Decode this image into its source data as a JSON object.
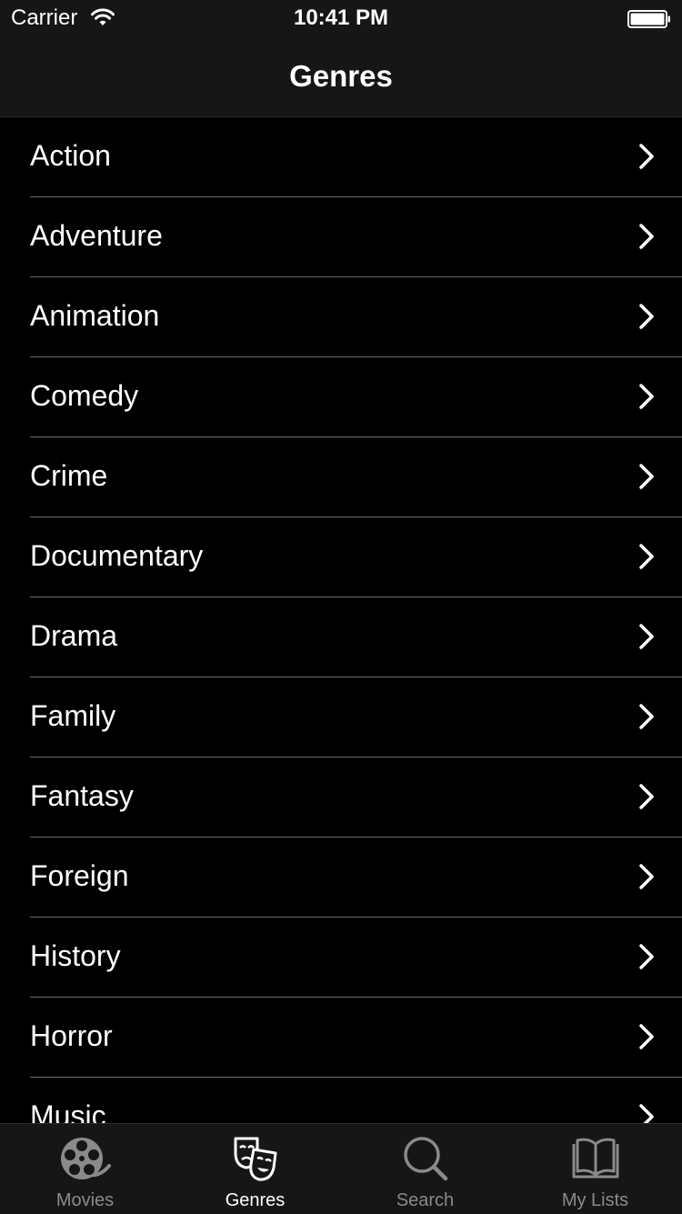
{
  "status_bar": {
    "carrier": "Carrier",
    "time": "10:41 PM"
  },
  "nav": {
    "title": "Genres"
  },
  "genres": [
    {
      "label": "Action"
    },
    {
      "label": "Adventure"
    },
    {
      "label": "Animation"
    },
    {
      "label": "Comedy"
    },
    {
      "label": "Crime"
    },
    {
      "label": "Documentary"
    },
    {
      "label": "Drama"
    },
    {
      "label": "Family"
    },
    {
      "label": "Fantasy"
    },
    {
      "label": "Foreign"
    },
    {
      "label": "History"
    },
    {
      "label": "Horror"
    },
    {
      "label": "Music"
    }
  ],
  "tabs": [
    {
      "label": "Movies",
      "icon": "film-reel-icon"
    },
    {
      "label": "Genres",
      "icon": "theater-masks-icon",
      "selected": true
    },
    {
      "label": "Search",
      "icon": "search-icon"
    },
    {
      "label": "My Lists",
      "icon": "book-icon"
    }
  ],
  "colors": {
    "background": "#000000",
    "bar_background": "#161616",
    "separator": "#6b6b6b",
    "text": "#ffffff",
    "tab_inactive": "#8a8a8a"
  }
}
